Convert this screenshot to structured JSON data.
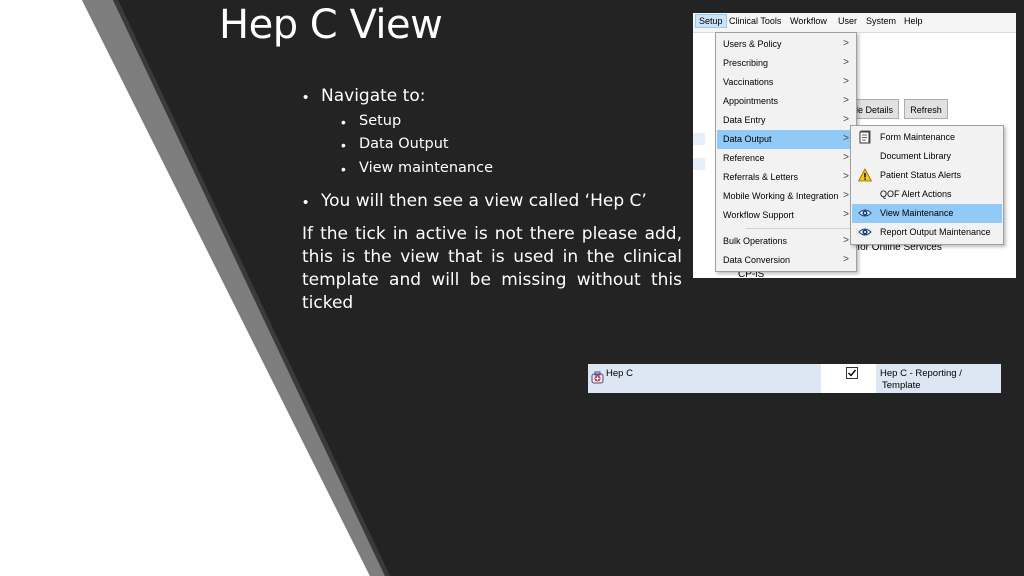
{
  "slide": {
    "title": "Hep C View",
    "nav_heading": "Navigate to:",
    "nav_steps": [
      "Setup",
      "Data Output",
      "View maintenance"
    ],
    "view_note": "You will then see a view called ‘Hep C’",
    "paragraph": "If the tick in active is not there please add, this is the view that is used in the clinical template and will be missing without this ticked"
  },
  "screenshot_menu": {
    "menubar": [
      "Setup",
      "Clinical Tools",
      "Workflow",
      "User",
      "System",
      "Help"
    ],
    "active_menu": "Setup",
    "background_buttons": [
      "le Details",
      "Refresh"
    ],
    "background_text": [
      "d for Online Services",
      "CP-iS"
    ],
    "setup_items": [
      {
        "label": "Users & Policy",
        "submenu": true
      },
      {
        "label": "Prescribing",
        "submenu": true
      },
      {
        "label": "Vaccinations",
        "submenu": true
      },
      {
        "label": "Appointments",
        "submenu": true
      },
      {
        "label": "Data Entry",
        "submenu": true
      },
      {
        "label": "Data Output",
        "submenu": true,
        "highlighted": true
      },
      {
        "label": "Reference",
        "submenu": true
      },
      {
        "label": "Referrals & Letters",
        "submenu": true
      },
      {
        "label": "Mobile Working & Integration",
        "submenu": true
      },
      {
        "label": "Workflow Support",
        "submenu": true
      },
      {
        "label": "Bulk Operations",
        "submenu": true
      },
      {
        "label": "Data Conversion",
        "submenu": true
      }
    ],
    "data_output_items": [
      {
        "label": "Form Maintenance",
        "icon": "form-icon"
      },
      {
        "label": "Document Library",
        "icon": "none"
      },
      {
        "label": "Patient Status Alerts",
        "icon": "warning-icon"
      },
      {
        "label": "QOF Alert Actions",
        "icon": "none"
      },
      {
        "label": "View Maintenance",
        "icon": "eye-icon",
        "highlighted": true
      },
      {
        "label": "Report Output Maintenance",
        "icon": "eye-icon"
      }
    ],
    "arrow_glyph": ">"
  },
  "screenshot_view": {
    "view_name": "Hep C",
    "active_checked": true,
    "description_line1": "Hep C - Reporting /",
    "description_line2": "Template",
    "icon": "clinical-view-icon"
  }
}
